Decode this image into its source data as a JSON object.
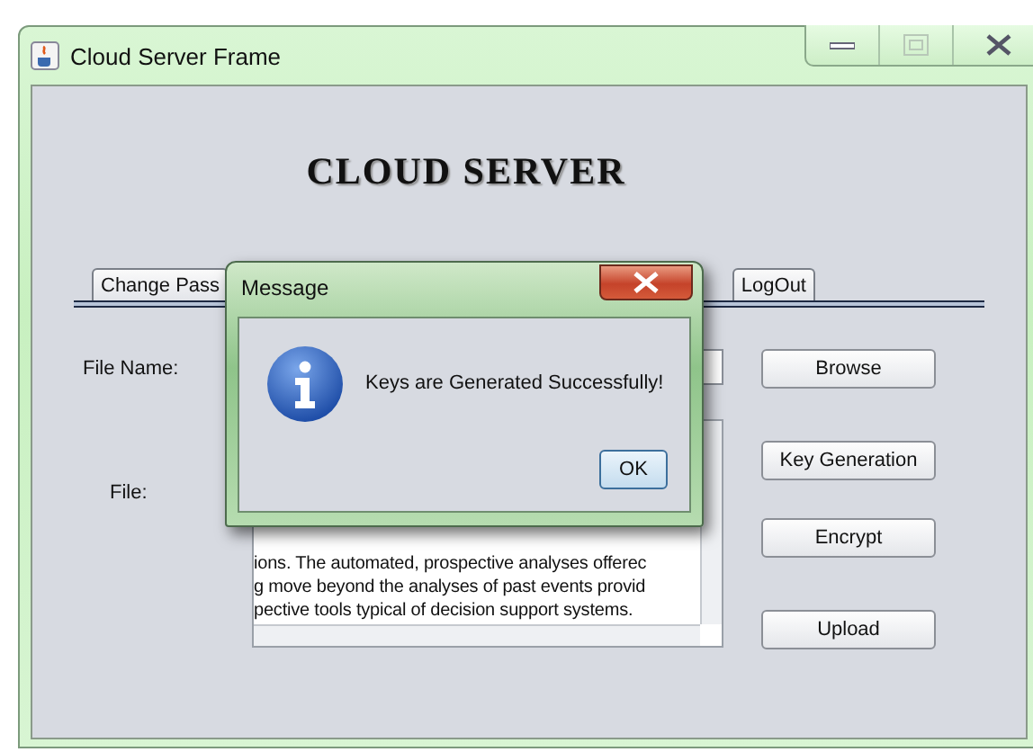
{
  "window": {
    "title": "Cloud Server Frame"
  },
  "heading": "CLOUD SERVER",
  "tabs": [
    {
      "label": "Change Pass",
      "selected": false
    },
    {
      "label": "LogOut",
      "selected": false
    }
  ],
  "form": {
    "file_name_label": "File Name:",
    "file_label": "File:",
    "file_lines": [
      "ions. The automated, prospective analyses offerec",
      "g move beyond the analyses of past events provid",
      "pective tools typical of decision support systems."
    ]
  },
  "buttons": [
    {
      "label": "Browse"
    },
    {
      "label": "Key Generation"
    },
    {
      "label": "Encrypt"
    },
    {
      "label": "Upload"
    }
  ],
  "dialog": {
    "title": "Message",
    "kind": "info",
    "message": "Keys are Generated Successfully!",
    "button": "OK"
  }
}
